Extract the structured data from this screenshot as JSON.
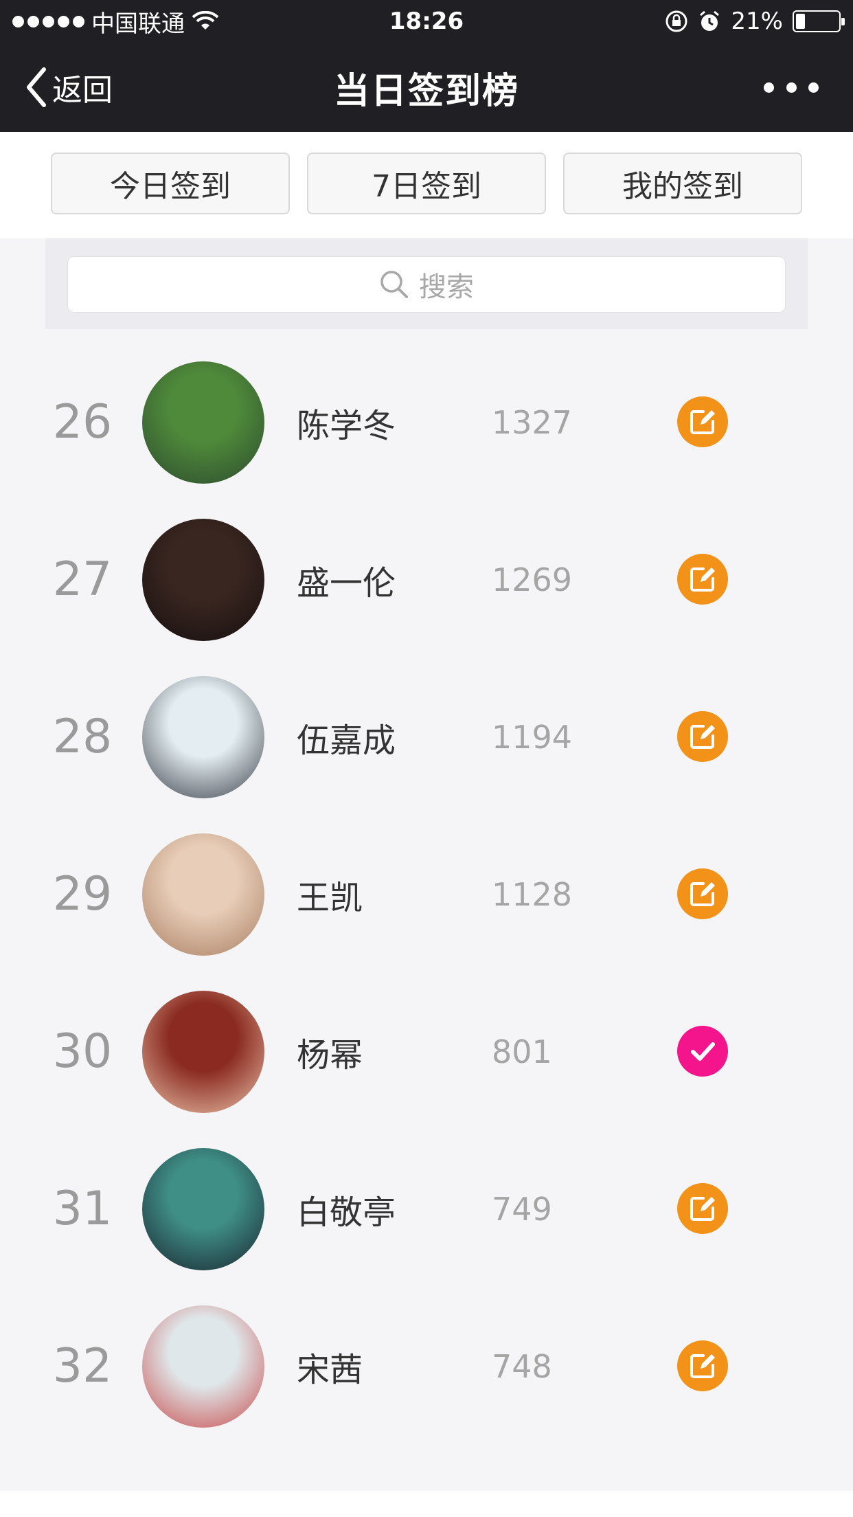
{
  "status_bar": {
    "carrier": "中国联通",
    "time": "18:26",
    "battery": "21%",
    "battery_level": 0.21
  },
  "nav": {
    "back_label": "返回",
    "title": "当日签到榜"
  },
  "tabs": [
    {
      "label": "今日签到"
    },
    {
      "label": "7日签到"
    },
    {
      "label": "我的签到"
    }
  ],
  "search": {
    "placeholder": "搜索"
  },
  "colors": {
    "edit_action": "#f39219",
    "checked_action": "#f4148c"
  },
  "rows": [
    {
      "rank": "26",
      "name": "陈学冬",
      "score": "1327",
      "status": "edit"
    },
    {
      "rank": "27",
      "name": "盛一伦",
      "score": "1269",
      "status": "edit"
    },
    {
      "rank": "28",
      "name": "伍嘉成",
      "score": "1194",
      "status": "edit"
    },
    {
      "rank": "29",
      "name": "王凯",
      "score": "1128",
      "status": "edit"
    },
    {
      "rank": "30",
      "name": "杨幂",
      "score": "801",
      "status": "checked"
    },
    {
      "rank": "31",
      "name": "白敬亭",
      "score": "749",
      "status": "edit"
    },
    {
      "rank": "32",
      "name": "宋茜",
      "score": "748",
      "status": "edit"
    }
  ]
}
